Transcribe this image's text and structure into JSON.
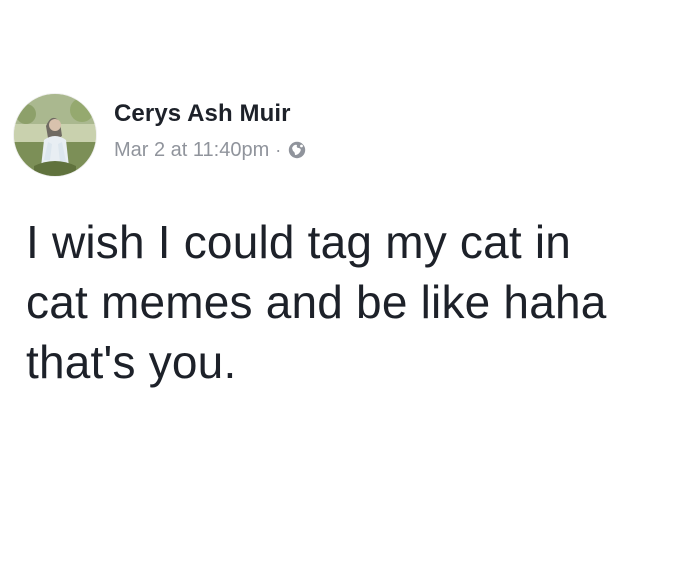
{
  "post": {
    "author": "Cerys Ash Muir",
    "timestamp": "Mar 2 at 11:40pm",
    "separator": "·",
    "privacy_icon": "globe-icon",
    "avatar_icon": "profile-photo",
    "text_lines": [
      "I wish I could tag my cat in",
      "cat memes and be like haha",
      "that's you."
    ]
  },
  "colors": {
    "author": "#1d2129",
    "meta": "#90949c",
    "text": "#1d2129",
    "background": "#ffffff"
  }
}
